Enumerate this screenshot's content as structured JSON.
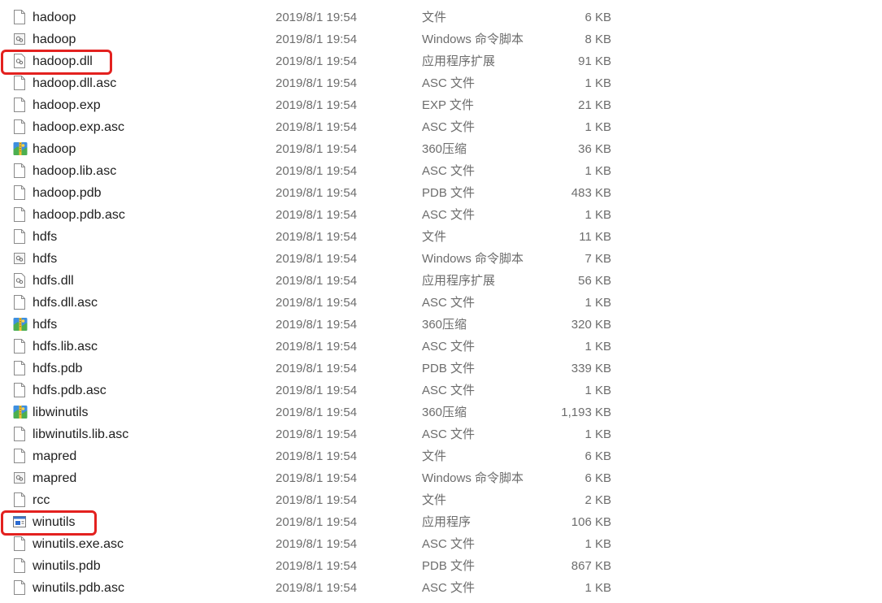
{
  "highlight_color": "#e3211f",
  "files": [
    {
      "name": "hadoop",
      "date": "2019/8/1 19:54",
      "type": "文件",
      "size": "6 KB",
      "icon": "blank-file-icon",
      "highlighted": false
    },
    {
      "name": "hadoop",
      "date": "2019/8/1 19:54",
      "type": "Windows 命令脚本",
      "size": "8 KB",
      "icon": "script-file-icon",
      "highlighted": false
    },
    {
      "name": "hadoop.dll",
      "date": "2019/8/1 19:54",
      "type": "应用程序扩展",
      "size": "91 KB",
      "icon": "dll-file-icon",
      "highlighted": true
    },
    {
      "name": "hadoop.dll.asc",
      "date": "2019/8/1 19:54",
      "type": "ASC 文件",
      "size": "1 KB",
      "icon": "blank-file-icon",
      "highlighted": false
    },
    {
      "name": "hadoop.exp",
      "date": "2019/8/1 19:54",
      "type": "EXP 文件",
      "size": "21 KB",
      "icon": "blank-file-icon",
      "highlighted": false
    },
    {
      "name": "hadoop.exp.asc",
      "date": "2019/8/1 19:54",
      "type": "ASC 文件",
      "size": "1 KB",
      "icon": "blank-file-icon",
      "highlighted": false
    },
    {
      "name": "hadoop",
      "date": "2019/8/1 19:54",
      "type": "360压缩",
      "size": "36 KB",
      "icon": "archive-file-icon",
      "highlighted": false
    },
    {
      "name": "hadoop.lib.asc",
      "date": "2019/8/1 19:54",
      "type": "ASC 文件",
      "size": "1 KB",
      "icon": "blank-file-icon",
      "highlighted": false
    },
    {
      "name": "hadoop.pdb",
      "date": "2019/8/1 19:54",
      "type": "PDB 文件",
      "size": "483 KB",
      "icon": "blank-file-icon",
      "highlighted": false
    },
    {
      "name": "hadoop.pdb.asc",
      "date": "2019/8/1 19:54",
      "type": "ASC 文件",
      "size": "1 KB",
      "icon": "blank-file-icon",
      "highlighted": false
    },
    {
      "name": "hdfs",
      "date": "2019/8/1 19:54",
      "type": "文件",
      "size": "11 KB",
      "icon": "blank-file-icon",
      "highlighted": false
    },
    {
      "name": "hdfs",
      "date": "2019/8/1 19:54",
      "type": "Windows 命令脚本",
      "size": "7 KB",
      "icon": "script-file-icon",
      "highlighted": false
    },
    {
      "name": "hdfs.dll",
      "date": "2019/8/1 19:54",
      "type": "应用程序扩展",
      "size": "56 KB",
      "icon": "dll-file-icon",
      "highlighted": false
    },
    {
      "name": "hdfs.dll.asc",
      "date": "2019/8/1 19:54",
      "type": "ASC 文件",
      "size": "1 KB",
      "icon": "blank-file-icon",
      "highlighted": false
    },
    {
      "name": "hdfs",
      "date": "2019/8/1 19:54",
      "type": "360压缩",
      "size": "320 KB",
      "icon": "archive-file-icon",
      "highlighted": false
    },
    {
      "name": "hdfs.lib.asc",
      "date": "2019/8/1 19:54",
      "type": "ASC 文件",
      "size": "1 KB",
      "icon": "blank-file-icon",
      "highlighted": false
    },
    {
      "name": "hdfs.pdb",
      "date": "2019/8/1 19:54",
      "type": "PDB 文件",
      "size": "339 KB",
      "icon": "blank-file-icon",
      "highlighted": false
    },
    {
      "name": "hdfs.pdb.asc",
      "date": "2019/8/1 19:54",
      "type": "ASC 文件",
      "size": "1 KB",
      "icon": "blank-file-icon",
      "highlighted": false
    },
    {
      "name": "libwinutils",
      "date": "2019/8/1 19:54",
      "type": "360压缩",
      "size": "1,193 KB",
      "icon": "archive-file-icon",
      "highlighted": false
    },
    {
      "name": "libwinutils.lib.asc",
      "date": "2019/8/1 19:54",
      "type": "ASC 文件",
      "size": "1 KB",
      "icon": "blank-file-icon",
      "highlighted": false
    },
    {
      "name": "mapred",
      "date": "2019/8/1 19:54",
      "type": "文件",
      "size": "6 KB",
      "icon": "blank-file-icon",
      "highlighted": false
    },
    {
      "name": "mapred",
      "date": "2019/8/1 19:54",
      "type": "Windows 命令脚本",
      "size": "6 KB",
      "icon": "script-file-icon",
      "highlighted": false
    },
    {
      "name": "rcc",
      "date": "2019/8/1 19:54",
      "type": "文件",
      "size": "2 KB",
      "icon": "blank-file-icon",
      "highlighted": false
    },
    {
      "name": "winutils",
      "date": "2019/8/1 19:54",
      "type": "应用程序",
      "size": "106 KB",
      "icon": "exe-file-icon",
      "highlighted": true
    },
    {
      "name": "winutils.exe.asc",
      "date": "2019/8/1 19:54",
      "type": "ASC 文件",
      "size": "1 KB",
      "icon": "blank-file-icon",
      "highlighted": false
    },
    {
      "name": "winutils.pdb",
      "date": "2019/8/1 19:54",
      "type": "PDB 文件",
      "size": "867 KB",
      "icon": "blank-file-icon",
      "highlighted": false
    },
    {
      "name": "winutils.pdb.asc",
      "date": "2019/8/1 19:54",
      "type": "ASC 文件",
      "size": "1 KB",
      "icon": "blank-file-icon",
      "highlighted": false
    }
  ]
}
